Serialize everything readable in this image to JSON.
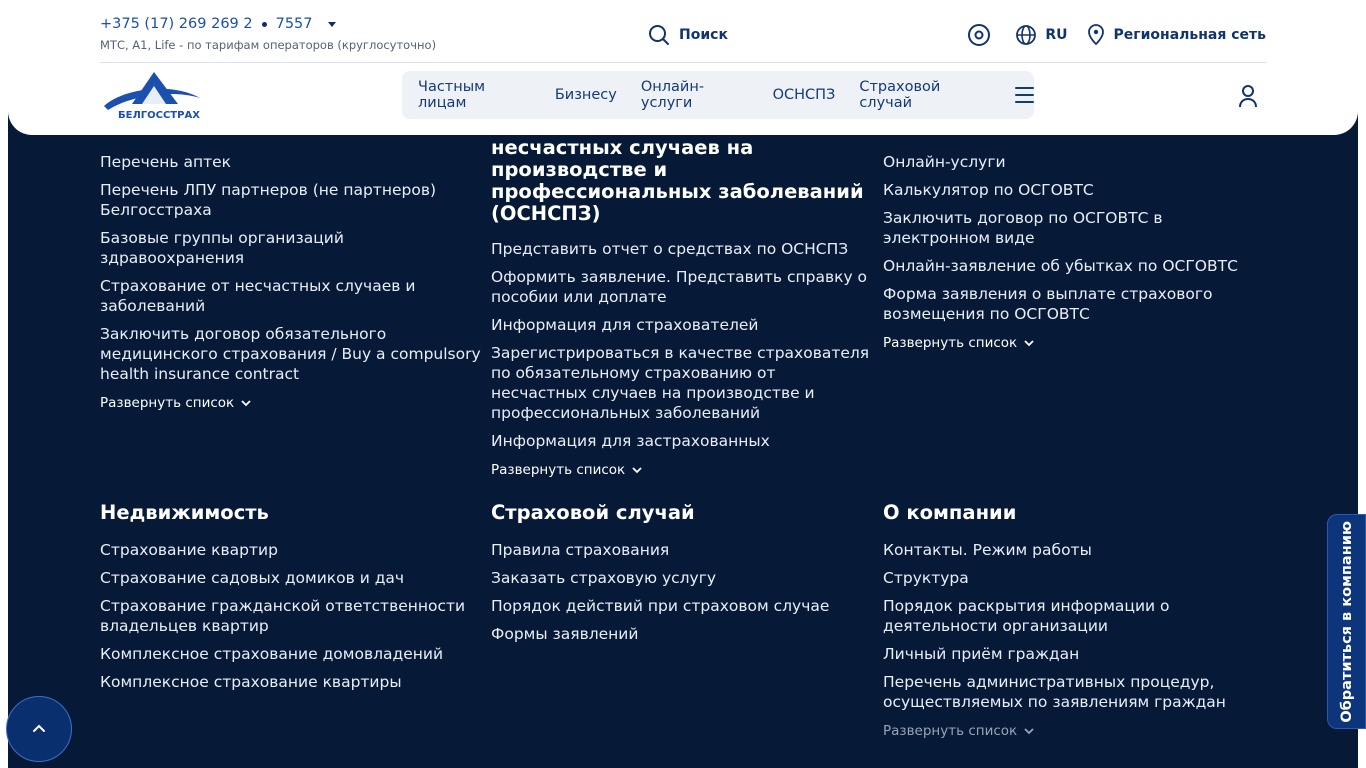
{
  "header": {
    "phone": "+375 (17) 269 269 2",
    "short_number": "7557",
    "phone_note": "МТС, A1, Life - по тарифам операторов (круглосуточно)",
    "search_label": "Поиск",
    "lang": "RU",
    "regional_label": "Региональная сеть",
    "logo_text": "БЕЛГОССТРАХ",
    "nav": [
      "Частным лицам",
      "Бизнесу",
      "Онлайн-услуги",
      "ОСНСПЗ",
      "Страховой случай"
    ]
  },
  "columns_top": [
    {
      "title_partial": "",
      "links": [
        "Перечень аптек",
        "Перечень ЛПУ партнеров (не партнеров) Белгосстраха",
        "Базовые группы организаций здравоохранения",
        "Страхование от несчастных случаев и заболеваний",
        "Заключить договор обязательного медицинского страхования / Buy a compulsory health insurance contract"
      ],
      "expand_label": "Развернуть список"
    },
    {
      "title_partial": "несчастных случаев на производстве и профессиональных заболеваний (ОСНСПЗ)",
      "links": [
        "Представить отчет о средствах по ОСНСПЗ",
        "Оформить заявление. Представить справку о пособии или доплате",
        "Информация для страхователей",
        "Зарегистрироваться в качестве страхователя по обязательному страхованию от несчастных случаев на производстве и профессиональных заболеваний",
        "Информация для застрахованных"
      ],
      "expand_label": "Развернуть список"
    },
    {
      "title_partial": "",
      "links": [
        "Онлайн-услуги",
        "Калькулятор по ОСГОВТС",
        "Заключить договор по ОСГОВТС в электронном виде",
        "Онлайн-заявление об убытках по ОСГОВТС",
        "Форма заявления о выплате страхового возмещения по ОСГОВТС"
      ],
      "expand_label": "Развернуть список"
    }
  ],
  "columns_bottom": [
    {
      "title": "Недвижимость",
      "links": [
        "Страхование квартир",
        "Страхование садовых домиков и дач",
        "Страхование гражданской ответственности владельцев квартир",
        "Комплексное страхование домовладений",
        "Комплексное страхование квартиры"
      ]
    },
    {
      "title": "Страховой случай",
      "links": [
        "Правила страхования",
        "Заказать страховую услугу",
        "Порядок действий при страховом случае",
        "Формы заявлений"
      ]
    },
    {
      "title": "О компании",
      "links": [
        "Контакты. Режим работы",
        "Структура",
        "Порядок раскрытия информации о деятельности организации",
        "Личный приём граждан",
        "Перечень административных процедур, осуществляемых по заявлениям граждан"
      ],
      "expand_label": "Развернуть список"
    }
  ],
  "contact_tab": "Обратиться в компанию",
  "colors": {
    "footer_bg": "#061a38",
    "brand_blue": "#1b4fb0",
    "tab_bg": "#0d357c"
  }
}
